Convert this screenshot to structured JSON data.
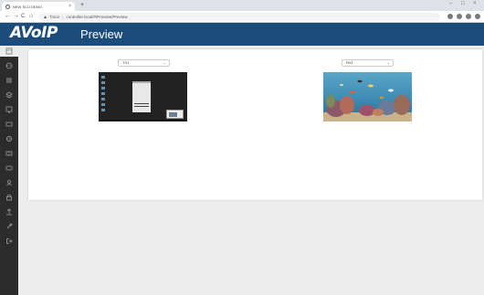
{
  "browser": {
    "tab_title": "NEW SCU DEMO",
    "tab_close": "×",
    "new_tab": "+",
    "window_controls": [
      "–",
      "□",
      "×"
    ],
    "nav": [
      "←",
      "→",
      "C",
      "⌂"
    ],
    "omnibox": {
      "warning_icon": "warning-triangle-icon",
      "not_secure": "Trace",
      "url": "controller.local/#/Preview/Preview"
    }
  },
  "app": {
    "logo": "AVoIP",
    "page_title": "Preview"
  },
  "sidebar": {
    "items": [
      "dashboard-icon",
      "globe-icon",
      "list-icon",
      "layers-icon",
      "monitor-icon",
      "display-icon",
      "settings-icon",
      "grid-icon",
      "sliders-icon",
      "user-icon",
      "lock-icon",
      "upload-icon",
      "wrench-icon",
      "logout-icon"
    ]
  },
  "main": {
    "previews": [
      {
        "selected": "TX1",
        "arrow": "⌄",
        "kind": "desktop"
      },
      {
        "selected": "RX1",
        "arrow": "⌄",
        "kind": "aquarium"
      }
    ]
  }
}
